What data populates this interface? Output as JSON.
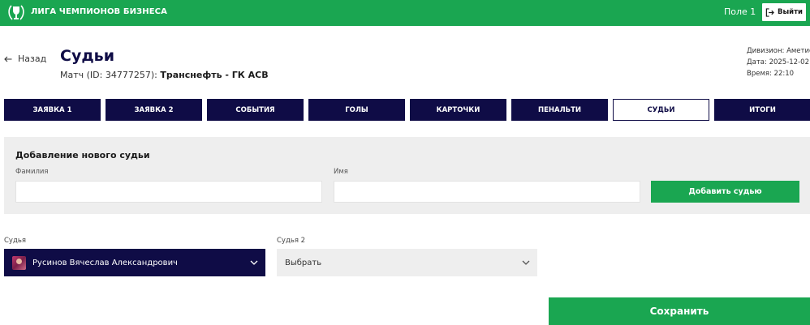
{
  "colors": {
    "brand_green": "#1aa651",
    "navy": "#0f0c46",
    "panel_gray": "#eeeeee"
  },
  "header": {
    "brand": "ЛИГА ЧЕМПИОНОВ БИЗНЕСА",
    "logo_icon": "trophy-wreath-icon",
    "field": "Поле 1",
    "logout_label": "Выйти",
    "logout_icon": "logout-icon"
  },
  "page": {
    "back_label": "Назад",
    "title": "Судьи",
    "match_prefix": "Матч (ID: 34777257):",
    "match_teams": "Транснефть - ГК АСВ",
    "division": "Дивизион: Аметист",
    "date": "Дата: 2025-12-02",
    "time": "Время: 22:10"
  },
  "tabs": [
    {
      "label": "ЗАЯВКА 1",
      "active": false
    },
    {
      "label": "ЗАЯВКА 2",
      "active": false
    },
    {
      "label": "СОБЫТИЯ",
      "active": false
    },
    {
      "label": "ГОЛЫ",
      "active": false
    },
    {
      "label": "КАРТОЧКИ",
      "active": false
    },
    {
      "label": "ПЕНАЛЬТИ",
      "active": false
    },
    {
      "label": "СУДЬИ",
      "active": true
    },
    {
      "label": "ИТОГИ",
      "active": false
    }
  ],
  "add_referee": {
    "title": "Добавление нового судьи",
    "surname_label": "Фамилия",
    "surname_value": "",
    "name_label": "Имя",
    "name_value": "",
    "button_label": "Добавить судью"
  },
  "referees": {
    "ref1_label": "Судья",
    "ref1_value": "Русинов Вячеслав Александрович",
    "ref2_label": "Судья 2",
    "ref2_value": "Выбрать"
  },
  "save_label": "Сохранить"
}
